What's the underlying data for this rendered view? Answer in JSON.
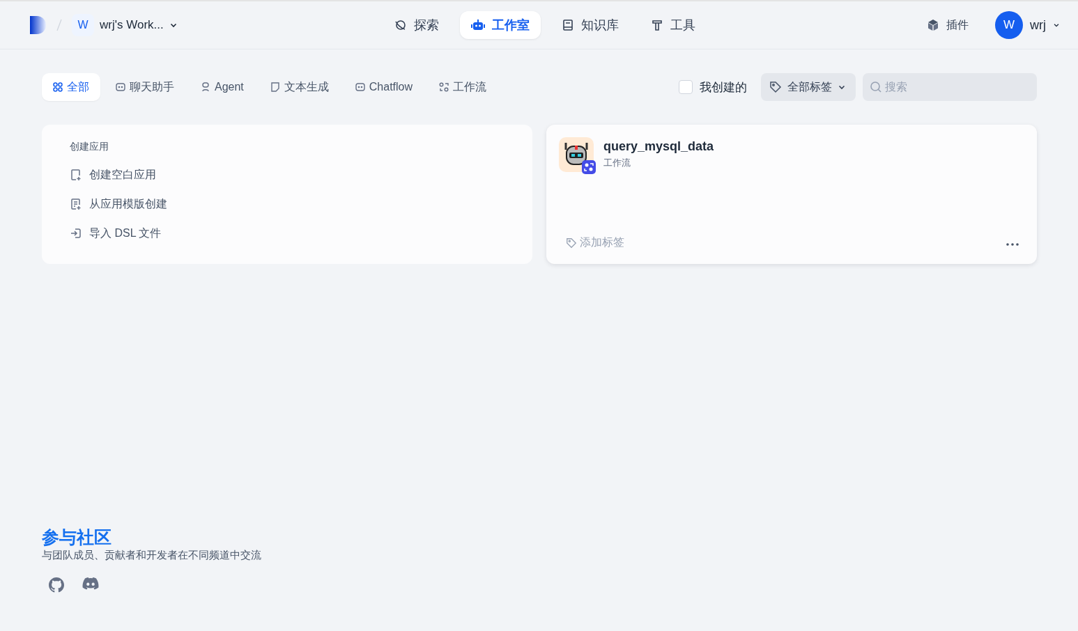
{
  "header": {
    "workspace": {
      "initial": "W",
      "name": "wrj's Work..."
    },
    "nav": [
      {
        "kind": "explore",
        "label": "探索",
        "selected": false
      },
      {
        "kind": "studio",
        "label": "工作室",
        "selected": true
      },
      {
        "kind": "knowledge",
        "label": "知识库",
        "selected": false
      },
      {
        "kind": "tools",
        "label": "工具",
        "selected": false
      }
    ],
    "plugins": "插件",
    "user": {
      "initial": "W",
      "name": "wrj"
    }
  },
  "filters": {
    "tabs": [
      {
        "kind": "all",
        "label": "全部",
        "selected": true
      },
      {
        "kind": "chat",
        "label": "聊天助手",
        "selected": false
      },
      {
        "kind": "agent",
        "label": "Agent",
        "selected": false
      },
      {
        "kind": "text",
        "label": "文本生成",
        "selected": false
      },
      {
        "kind": "chatflow",
        "label": "Chatflow",
        "selected": false
      },
      {
        "kind": "workflow",
        "label": "工作流",
        "selected": false
      }
    ],
    "created_by_me": {
      "label": "我创建的",
      "checked": false
    },
    "tags": "全部标签",
    "search": {
      "placeholder": "搜索"
    }
  },
  "create_card": {
    "title": "创建应用",
    "actions": [
      {
        "kind": "blank",
        "label": "创建空白应用"
      },
      {
        "kind": "template",
        "label": "从应用模版创建"
      },
      {
        "kind": "import",
        "label": "导入 DSL 文件"
      }
    ]
  },
  "apps": [
    {
      "name": "query_mysql_data",
      "type": "工作流",
      "add_tag": "添加标签"
    }
  ],
  "community": {
    "title": "参与社区",
    "description": "与团队成员、贡献者和开发者在不同频道中交流"
  }
}
